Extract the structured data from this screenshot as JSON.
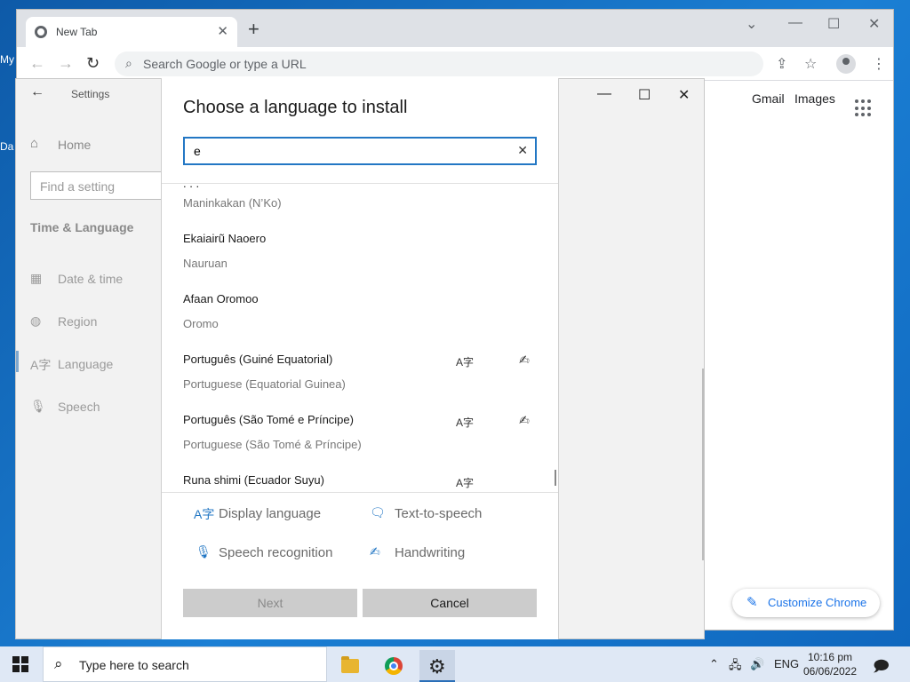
{
  "desktop": {
    "label_1": "My",
    "label_2": "Da"
  },
  "chrome": {
    "tab_title": "New Tab",
    "omnibox_placeholder": "Search Google or type a URL",
    "gmail": "Gmail",
    "images": "Images",
    "customize_label": "Customize Chrome"
  },
  "settings": {
    "title": "Settings",
    "home": "Home",
    "find_placeholder": "Find a setting",
    "section": "Time & Language",
    "nav": [
      {
        "label": "Date & time",
        "icon": "calendar-icon"
      },
      {
        "label": "Region",
        "icon": "globe-icon"
      },
      {
        "label": "Language",
        "icon": "language-icon"
      },
      {
        "label": "Speech",
        "icon": "microphone-icon"
      }
    ]
  },
  "dialog": {
    "title": "Choose a language to install",
    "search_value": "e",
    "languages": [
      {
        "native": "",
        "english": "Maninkakan (N’Ko)",
        "display": false,
        "handwriting": false
      },
      {
        "native": "Ekaiairũ Naoero",
        "english": "Nauruan",
        "display": false,
        "handwriting": false
      },
      {
        "native": "Afaan Oromoo",
        "english": "Oromo",
        "display": false,
        "handwriting": false
      },
      {
        "native": "Português (Guiné Equatorial)",
        "english": "Portuguese (Equatorial Guinea)",
        "display": true,
        "handwriting": true
      },
      {
        "native": "Português (São Tomé e Príncipe)",
        "english": "Portuguese (São Tomé & Príncipe)",
        "display": true,
        "handwriting": true
      },
      {
        "native": "Runa shimi (Ecuador Suyu)",
        "english": "",
        "display": true,
        "handwriting": false
      }
    ],
    "features": {
      "display_language": "Display language",
      "text_to_speech": "Text-to-speech",
      "speech_recognition": "Speech recognition",
      "handwriting": "Handwriting"
    },
    "next_label": "Next",
    "cancel_label": "Cancel"
  },
  "taskbar": {
    "search_text": "Type here to search",
    "lang": "ENG",
    "time": "10:16 pm",
    "date": "06/06/2022"
  },
  "colors": {
    "accent": "#2377c4",
    "desktop": "#1b7fd4"
  }
}
